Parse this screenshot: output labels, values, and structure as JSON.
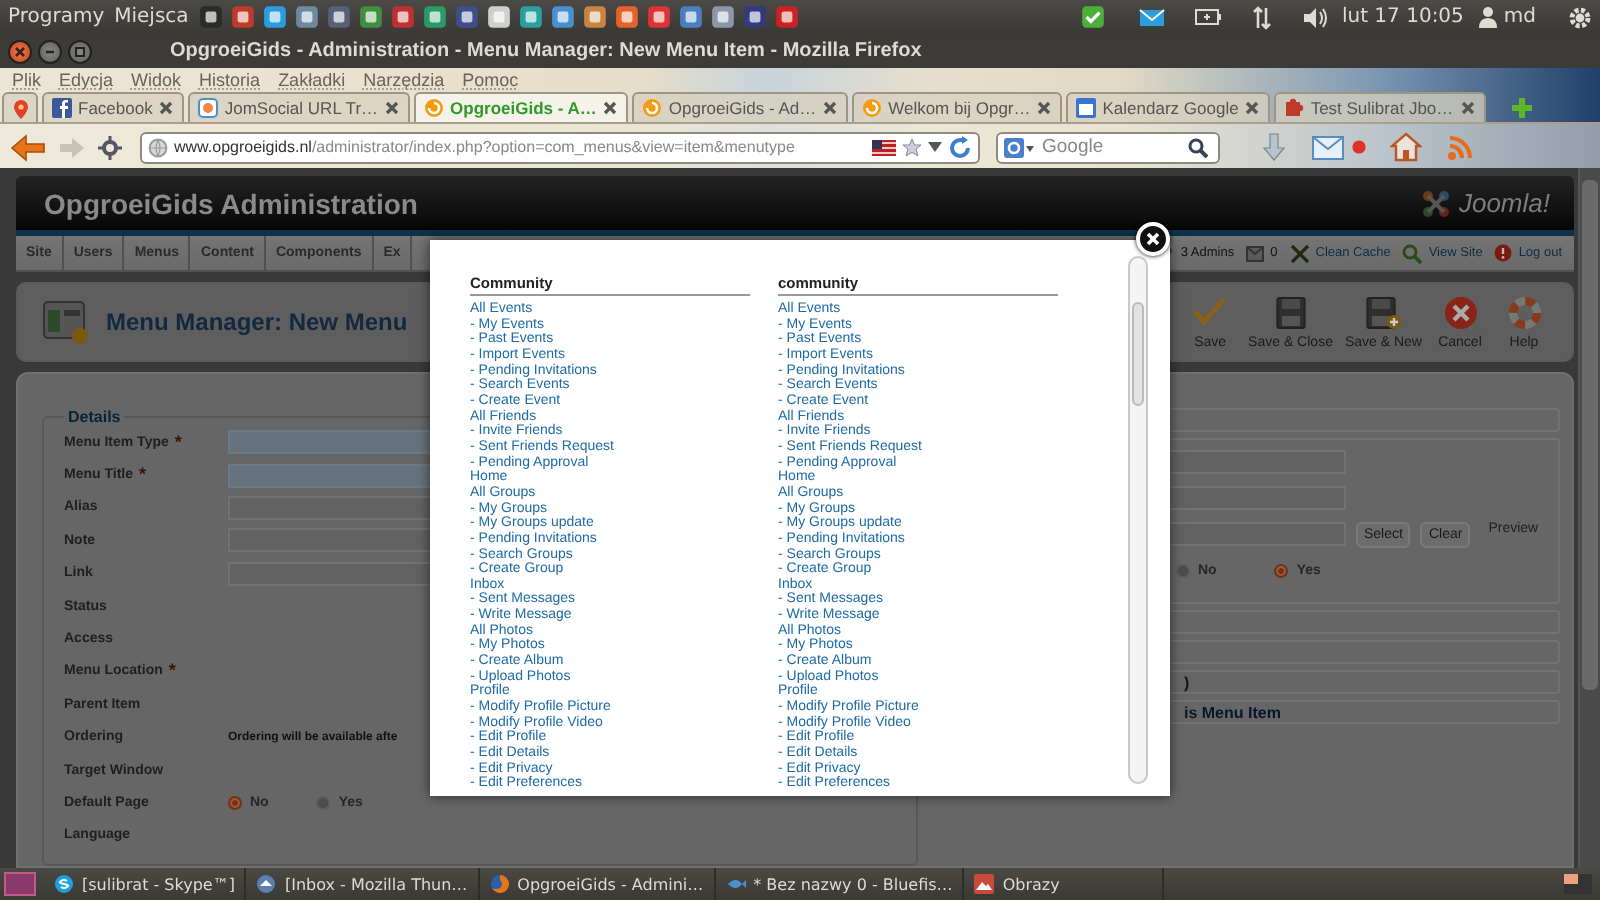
{
  "top_panel": {
    "menus": [
      "Programy",
      "Miejsca"
    ],
    "clock": "lut 17 10:05",
    "user": "md"
  },
  "window": {
    "title": "OpgroeiGids - Administration - Menu Manager: New Menu Item - Mozilla Firefox"
  },
  "menubar": [
    "Plik",
    "Edycja",
    "Widok",
    "Historia",
    "Zakładki",
    "Narzędzia",
    "Pomoc"
  ],
  "tabs": [
    {
      "kind": "pinned",
      "selected": false
    },
    {
      "kind": "facebook",
      "label": "Facebook",
      "selected": false
    },
    {
      "kind": "web",
      "label": "JomSocial URL Tr…",
      "selected": false
    },
    {
      "kind": "site",
      "label": "OpgroeiGids - A…",
      "selected": true
    },
    {
      "kind": "site",
      "label": "OpgroeiGids - Ad…",
      "selected": false
    },
    {
      "kind": "site",
      "label": "Welkom bij Opgr…",
      "selected": false
    },
    {
      "kind": "calendar",
      "label": "Kalendarz Google",
      "selected": false
    },
    {
      "kind": "test",
      "label": "Test Sulibrat Jbo…",
      "selected": false
    }
  ],
  "address_bar": {
    "url": "www.opgroeigids.nl/administrator/index.php?option=com_menus&view=item&menutype"
  },
  "search": {
    "placeholder": "Google"
  },
  "admin": {
    "title": "OpgroeiGids Administration",
    "logo": "Joomla!",
    "menu": [
      "Site",
      "Users",
      "Menus",
      "Content",
      "Components",
      "Ex"
    ],
    "status": [
      {
        "kind": "users",
        "label": "3 Admins"
      },
      {
        "kind": "messages",
        "label": "0"
      },
      {
        "kind": "cache",
        "label": "Clean Cache"
      },
      {
        "kind": "site",
        "label": "View Site"
      },
      {
        "kind": "logout",
        "label": "Log out"
      }
    ],
    "page_title": "Menu Manager: New Menu",
    "toolbar": [
      {
        "kind": "save",
        "label": "Save"
      },
      {
        "kind": "save-close",
        "label": "Save & Close"
      },
      {
        "kind": "save-new",
        "label": "Save & New"
      },
      {
        "kind": "cancel",
        "label": "Cancel"
      },
      {
        "kind": "help",
        "label": "Help"
      }
    ],
    "form": {
      "legend": "Details",
      "fields": [
        {
          "label": "Menu Item Type",
          "marker": "*",
          "kind": "input",
          "invalid": true
        },
        {
          "label": "Menu Title",
          "marker": "*",
          "kind": "input",
          "invalid": true
        },
        {
          "label": "Alias",
          "kind": "input",
          "invalid": false
        },
        {
          "label": "Note",
          "kind": "input",
          "invalid": false
        },
        {
          "label": "Link",
          "kind": "input",
          "invalid": false
        },
        {
          "label": "Status",
          "kind": "blank"
        },
        {
          "label": "Access",
          "kind": "blank"
        },
        {
          "label": "Menu Location",
          "marker": "*",
          "kind": "blank"
        },
        {
          "label": "Parent Item",
          "kind": "blank"
        },
        {
          "label": "Ordering",
          "kind": "note",
          "value": "Ordering will be available afte"
        },
        {
          "label": "Target Window",
          "kind": "blank"
        },
        {
          "label": "Default Page",
          "kind": "radio",
          "options": [
            {
              "label": "No",
              "selected": true
            },
            {
              "label": "Yes",
              "selected": false
            }
          ]
        },
        {
          "label": "Language",
          "kind": "blank"
        }
      ]
    },
    "options_panel": {
      "rows": [
        {
          "kind": "input"
        },
        {
          "kind": "input"
        },
        {
          "kind": "image",
          "buttons": [
            "Select",
            "Clear"
          ],
          "label": "Preview"
        },
        {
          "kind": "radio",
          "options": [
            {
              "label": "No",
              "selected": false
            },
            {
              "label": "Yes",
              "selected": true
            }
          ]
        }
      ],
      "sections": [
        {
          "kind": "blank"
        },
        {
          "kind": "blank"
        },
        {
          "kind": "titled",
          "label": ")"
        },
        {
          "kind": "titled",
          "label": "is Menu Item"
        }
      ]
    }
  },
  "modal": {
    "columns": [
      {
        "heading": "Community",
        "items": [
          {
            "label": "All Events",
            "children": [
              {
                "label": "- My Events"
              },
              {
                "label": "- Past Events"
              },
              {
                "label": "- Import Events"
              },
              {
                "label": "- Pending Invitations"
              },
              {
                "label": "- Search Events"
              },
              {
                "label": "- Create Event"
              }
            ]
          },
          {
            "label": "All Friends",
            "children": [
              {
                "label": "- Invite Friends"
              },
              {
                "label": "- Sent Friends Request"
              },
              {
                "label": "- Pending Approval"
              }
            ]
          },
          {
            "label": "Home"
          },
          {
            "label": "All Groups",
            "children": [
              {
                "label": "- My Groups"
              },
              {
                "label": "- My Groups update"
              },
              {
                "label": "- Pending Invitations"
              },
              {
                "label": "- Search Groups"
              },
              {
                "label": "- Create Group"
              }
            ]
          },
          {
            "label": "Inbox",
            "children": [
              {
                "label": "- Sent Messages"
              },
              {
                "label": "- Write Message"
              }
            ]
          },
          {
            "label": "All Photos",
            "children": [
              {
                "label": "- My Photos"
              },
              {
                "label": "- Create Album"
              },
              {
                "label": "- Upload Photos"
              }
            ]
          },
          {
            "label": "Profile",
            "children": [
              {
                "label": "- Modify Profile Picture"
              },
              {
                "label": "- Modify Profile Video"
              },
              {
                "label": "- Edit Profile"
              },
              {
                "label": "- Edit Details"
              },
              {
                "label": "- Edit Privacy"
              },
              {
                "label": "- Edit Preferences"
              }
            ]
          }
        ]
      },
      {
        "heading": "community",
        "items": [
          {
            "label": "All Events",
            "children": [
              {
                "label": "- My Events"
              },
              {
                "label": "- Past Events"
              },
              {
                "label": "- Import Events"
              },
              {
                "label": "- Pending Invitations"
              },
              {
                "label": "- Search Events"
              },
              {
                "label": "- Create Event"
              }
            ]
          },
          {
            "label": "All Friends",
            "children": [
              {
                "label": "- Invite Friends"
              },
              {
                "label": "- Sent Friends Request"
              },
              {
                "label": "- Pending Approval"
              }
            ]
          },
          {
            "label": "Home"
          },
          {
            "label": "All Groups",
            "children": [
              {
                "label": "- My Groups"
              },
              {
                "label": "- My Groups update"
              },
              {
                "label": "- Pending Invitations"
              },
              {
                "label": "- Search Groups"
              },
              {
                "label": "- Create Group"
              }
            ]
          },
          {
            "label": "Inbox",
            "children": [
              {
                "label": "- Sent Messages"
              },
              {
                "label": "- Write Message"
              }
            ]
          },
          {
            "label": "All Photos",
            "children": [
              {
                "label": "- My Photos"
              },
              {
                "label": "- Create Album"
              },
              {
                "label": "- Upload Photos"
              }
            ]
          },
          {
            "label": "Profile",
            "children": [
              {
                "label": "- Modify Profile Picture"
              },
              {
                "label": "- Modify Profile Video"
              },
              {
                "label": "- Edit Profile"
              },
              {
                "label": "- Edit Details"
              },
              {
                "label": "- Edit Privacy"
              },
              {
                "label": "- Edit Preferences"
              }
            ]
          }
        ]
      }
    ]
  },
  "taskbar": [
    {
      "kind": "skype",
      "label": "[sulibrat - Skype™]"
    },
    {
      "kind": "mail",
      "label": "[Inbox - Mozilla Thun…"
    },
    {
      "kind": "browser",
      "label": "OpgroeiGids - Admini…"
    },
    {
      "kind": "editor",
      "label": "* Bez nazwy 0 - Bluefis…"
    },
    {
      "kind": "images",
      "label": "Obrazy"
    }
  ]
}
